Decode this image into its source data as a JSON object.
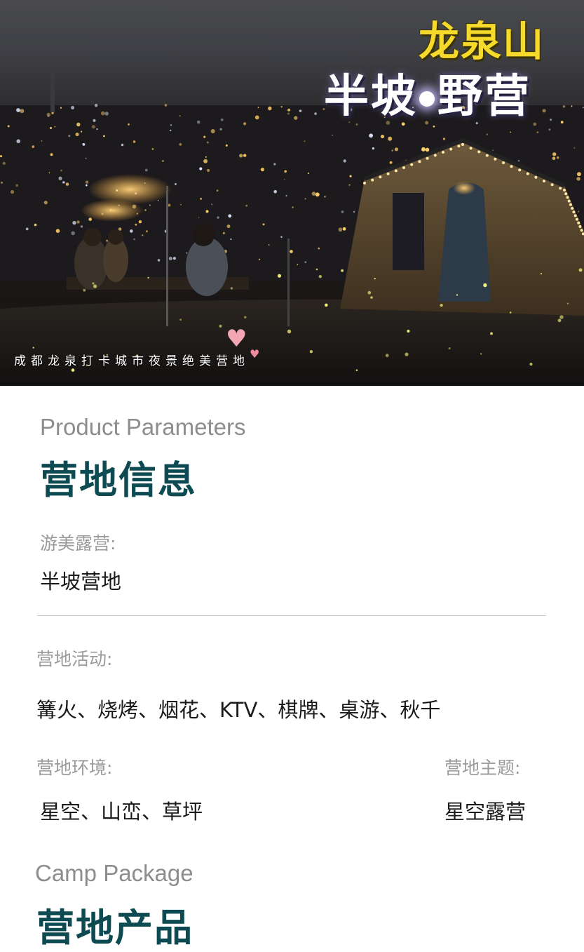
{
  "hero": {
    "title_top": "龙泉山",
    "title_main_left": "半坡",
    "title_main_right": "野营",
    "caption": "成都龙泉打卡城市夜景绝美营地"
  },
  "params": {
    "en_title": "Product Parameters",
    "cn_title": "营地信息",
    "name_label": "游美露营:",
    "name_value": "半坡营地",
    "activities_label": "营地活动:",
    "activities_value": "篝火、烧烤、烟花、KTV、棋牌、桌游、秋千",
    "environment_label": "营地环境:",
    "environment_value": "星空、山峦、草坪",
    "theme_label": "营地主题:",
    "theme_value": "星空露营"
  },
  "package": {
    "en_title": "Camp Package",
    "cn_title": "营地产品"
  },
  "colors": {
    "accent": "#0e4a52",
    "title_yellow": "#f5d92b",
    "muted": "#8d8d8d"
  }
}
